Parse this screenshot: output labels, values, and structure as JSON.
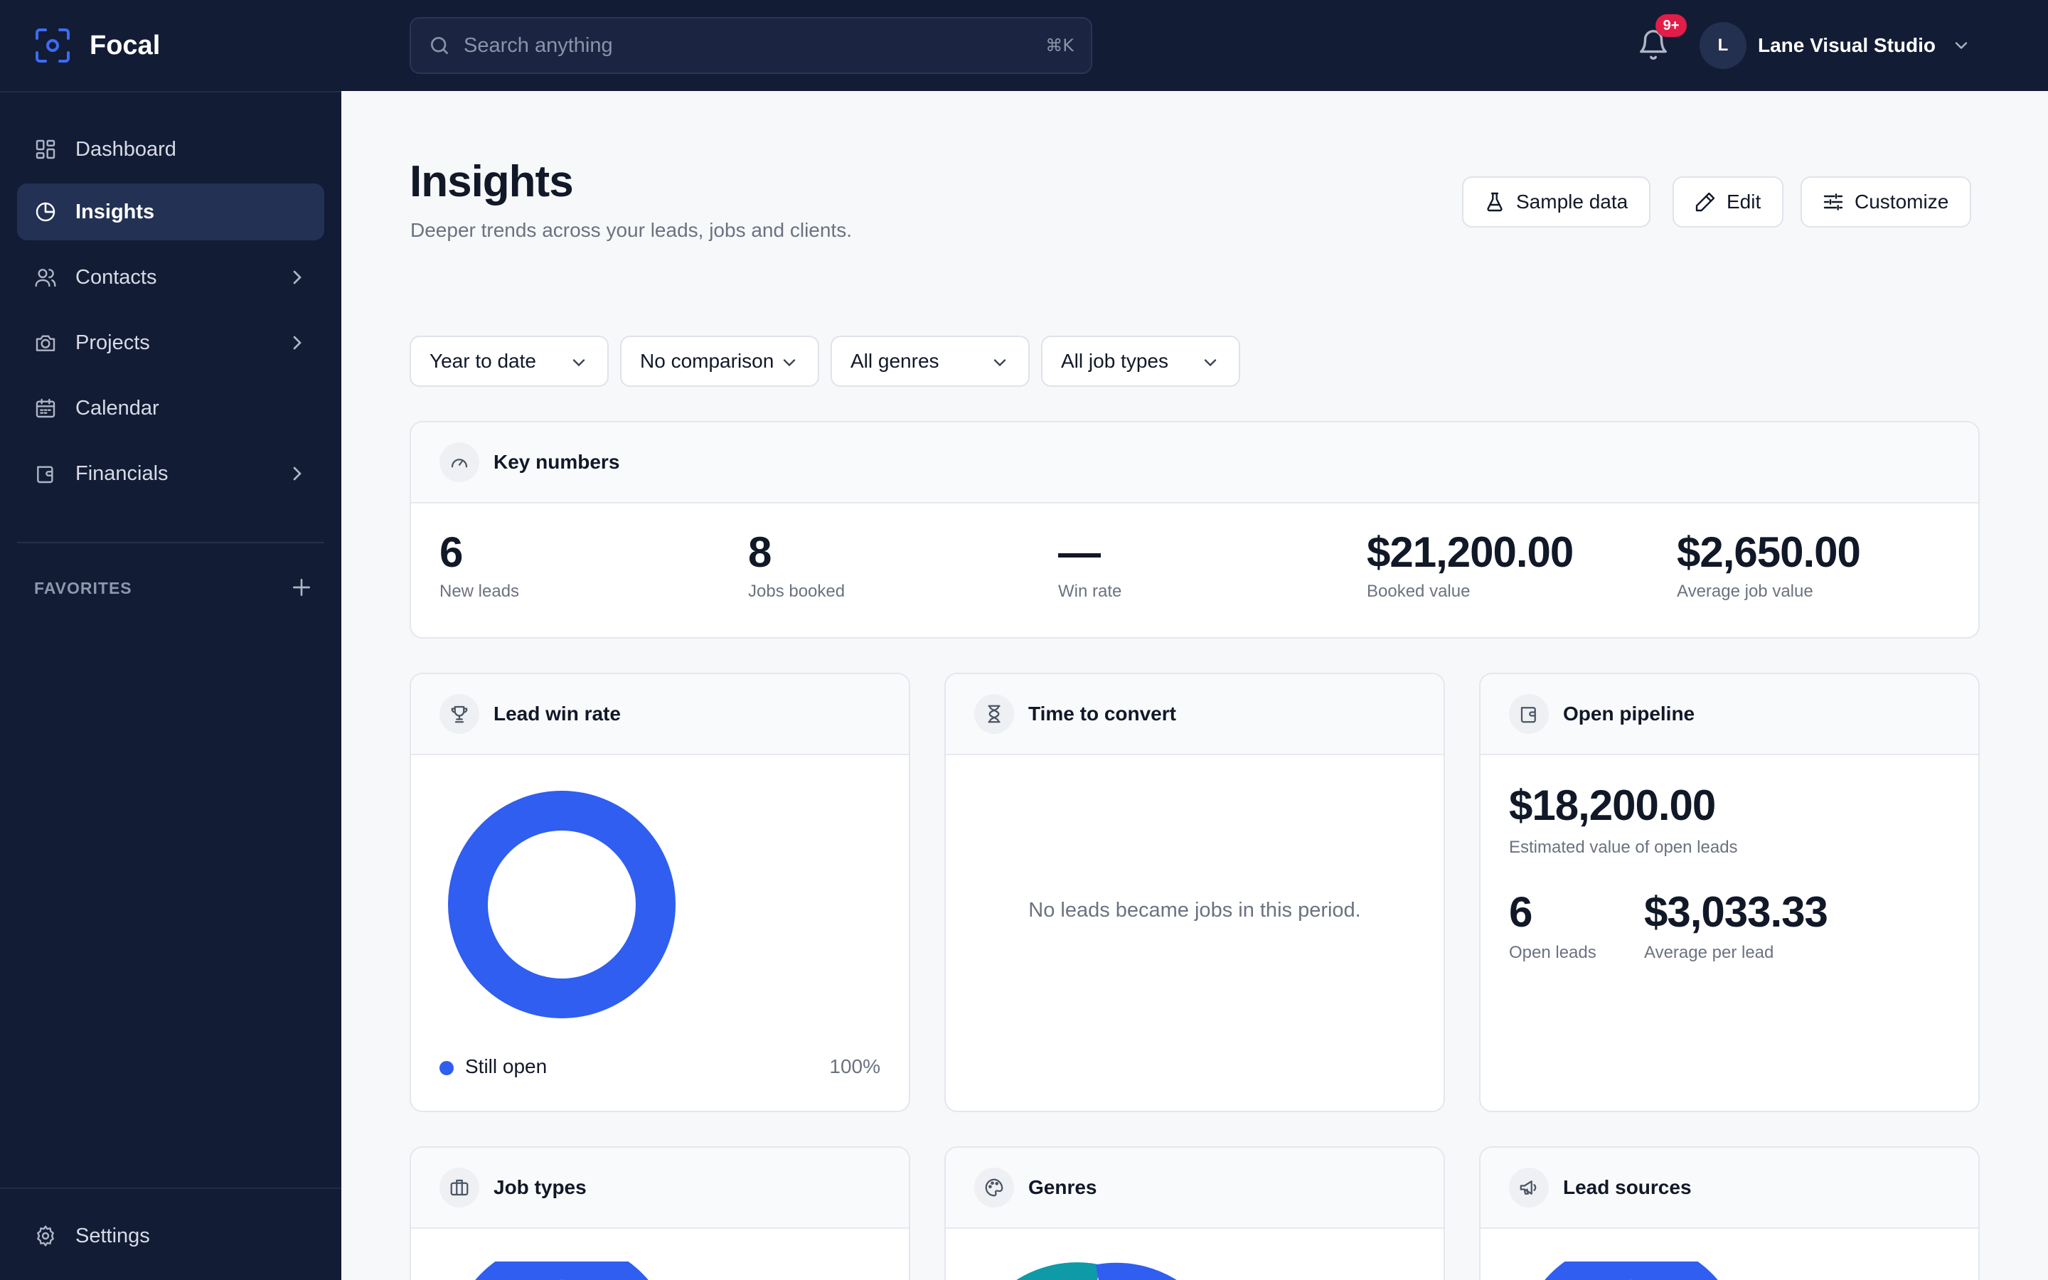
{
  "app": {
    "name": "Focal"
  },
  "search": {
    "placeholder": "Search anything",
    "shortcut": "⌘K"
  },
  "notifications": {
    "badge": "9+"
  },
  "account": {
    "initial": "L",
    "name": "Lane Visual Studio"
  },
  "sidebar": {
    "items": [
      {
        "label": "Dashboard",
        "icon": "grid-icon",
        "active": false
      },
      {
        "label": "Insights",
        "icon": "pie-chart-icon",
        "active": true
      },
      {
        "label": "Contacts",
        "icon": "users-icon",
        "expandable": true
      },
      {
        "label": "Projects",
        "icon": "camera-icon",
        "expandable": true
      },
      {
        "label": "Calendar",
        "icon": "calendar-icon",
        "expandable": false
      },
      {
        "label": "Financials",
        "icon": "wallet-icon",
        "expandable": true
      }
    ],
    "favorites_label": "FAVORITES",
    "settings_label": "Settings"
  },
  "page": {
    "title": "Insights",
    "subtitle": "Deeper trends across your leads, jobs and clients.",
    "actions": {
      "sample_data": "Sample data",
      "edit": "Edit",
      "customize": "Customize"
    }
  },
  "filters": [
    "Year to date",
    "No comparison",
    "All genres",
    "All job types"
  ],
  "key_numbers": {
    "title": "Key numbers",
    "items": [
      {
        "value": "6",
        "label": "New leads"
      },
      {
        "value": "8",
        "label": "Jobs booked"
      },
      {
        "value": "—",
        "label": "Win rate"
      },
      {
        "value": "$21,200.00",
        "label": "Booked value"
      },
      {
        "value": "$2,650.00",
        "label": "Average job value"
      }
    ]
  },
  "lead_win_rate": {
    "title": "Lead win rate",
    "legend": [
      {
        "label": "Still open",
        "percent": "100%",
        "color": "#2f5ef0"
      }
    ]
  },
  "time_to_convert": {
    "title": "Time to convert",
    "empty": "No leads became jobs in this period."
  },
  "open_pipeline": {
    "title": "Open pipeline",
    "value": "$18,200.00",
    "value_label": "Estimated value of open leads",
    "open_leads": "6",
    "open_leads_label": "Open leads",
    "avg": "$3,033.33",
    "avg_label": "Average per lead"
  },
  "bottom_cards": {
    "job_types": "Job types",
    "genres": "Genres",
    "lead_sources": "Lead sources"
  },
  "colors": {
    "accent": "#2f5ef0",
    "sidebar_bg": "#131c35",
    "teal": "#0e9aa7"
  }
}
